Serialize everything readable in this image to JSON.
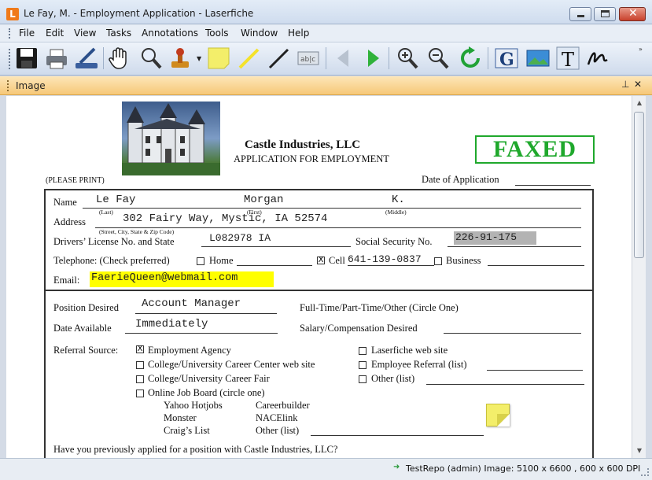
{
  "window": {
    "title": "Le Fay, M. - Employment Application - Laserfiche",
    "app_icon_letter": "L"
  },
  "menu": [
    "File",
    "Edit",
    "View",
    "Tasks",
    "Annotations",
    "Tools",
    "Window",
    "Help"
  ],
  "panel": {
    "title": "Image"
  },
  "document": {
    "company": "Castle Industries, LLC",
    "subtitle": "APPLICATION FOR EMPLOYMENT",
    "stamp": "FAXED",
    "please_print": "(PLEASE PRINT)",
    "date_label": "Date of Application",
    "name_label": "Name",
    "name_last": "Le Fay",
    "name_first": "Morgan",
    "name_middle": "K.",
    "sub_last": "(Last)",
    "sub_first": "(First)",
    "sub_middle": "(Middle)",
    "address_label": "Address",
    "address_value": "302 Fairy Way, Mystic, IA 52574",
    "address_hint": "(Street, City, State & Zip Code)",
    "license_label": "Drivers’ License No. and State",
    "license_value": "L082978 IA",
    "ssn_label": "Social Security No.",
    "ssn_value": "226-91-175",
    "telephone_label": "Telephone: (Check preferred)",
    "home_label": "Home",
    "cell_label": "Cell",
    "cell_value": "641-139-0837",
    "business_label": "Business",
    "email_label": "Email:",
    "email_value": "FaerieQueen@webmail.com",
    "position_label": "Position Desired",
    "position_value": "Account Manager",
    "fulltime_label": "Full-Time/Part-Time/Other (Circle One)",
    "available_label": "Date Available",
    "available_value": "Immediately",
    "salary_label": "Salary/Compensation Desired",
    "referral_label": "Referral Source:",
    "ref_agency": "Employment Agency",
    "ref_career_web": "College/University Career Center web site",
    "ref_career_fair": "College/University Career Fair",
    "ref_job_board": "Online Job Board (circle one)",
    "ref_laserfiche": "Laserfiche web site",
    "ref_employee": "Employee Referral (list)",
    "ref_other": "Other (list)",
    "board_yahoo": "Yahoo Hotjobs",
    "board_careerbuilder": "Careerbuilder",
    "board_monster": "Monster",
    "board_nacelink": "NACElink",
    "board_craigs": "Craig’s List",
    "board_other": "Other (list)",
    "previous_question": "Have you previously applied for a position with Castle Industries, LLC?"
  },
  "status": {
    "text": "TestRepo (admin)  Image: 5100 x 6600 , 600 x 600 DPI"
  },
  "colors": {
    "stamp_green": "#1fa82c",
    "highlight_yellow": "#ffff00",
    "redaction_gray": "#b3b3b3",
    "sticky_note": "#f3ee6a",
    "panel_orange": "#f6c878"
  }
}
